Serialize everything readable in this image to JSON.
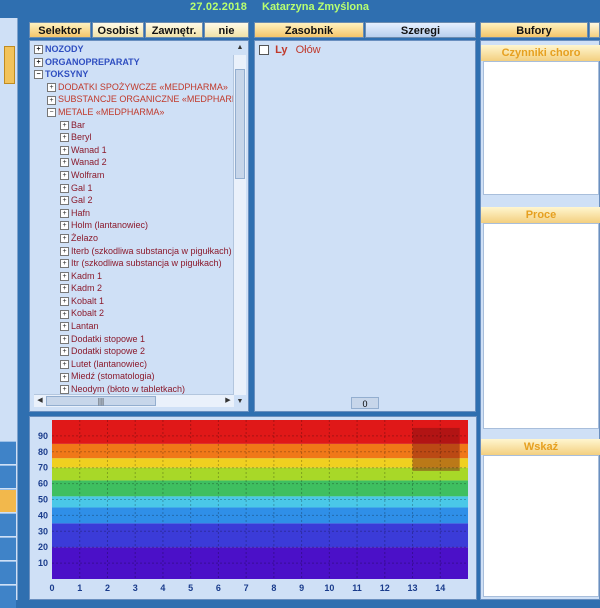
{
  "title": {
    "date": "27.02.2018",
    "user": "Katarzyna Zmyślona"
  },
  "tabs": [
    {
      "label": "Selektor",
      "active": true
    },
    {
      "label": "Osobist",
      "active": false
    },
    {
      "label": "Zawnętr.",
      "active": false
    },
    {
      "label": "nie",
      "active": false
    }
  ],
  "middle_tabs": [
    {
      "label": "Zasobnik",
      "active": true
    },
    {
      "label": "Szeregi",
      "active": false
    }
  ],
  "right_tabs": [
    {
      "label": "Bufory",
      "active": true
    }
  ],
  "tree": [
    {
      "label": "NOZODY",
      "level": 0
    },
    {
      "label": "ORGANOPREPARATY",
      "level": 0
    },
    {
      "label": "TOKSYNY",
      "level": 0
    },
    {
      "label": "DODATKI SPOŻYWCZE «MEDPHARMA»",
      "level": 1
    },
    {
      "label": "SUBSTANCJE ORGANICZNE «MEDPHARMA»",
      "level": 1
    },
    {
      "label": "METALE «MEDPHARMA»",
      "level": 1
    },
    {
      "label": "Bar",
      "level": 2
    },
    {
      "label": "Beryl",
      "level": 2
    },
    {
      "label": "Wanad 1",
      "level": 2
    },
    {
      "label": "Wanad 2",
      "level": 2
    },
    {
      "label": "Wolfram",
      "level": 2
    },
    {
      "label": "Gal 1",
      "level": 2
    },
    {
      "label": "Gal 2",
      "level": 2
    },
    {
      "label": "Hafn",
      "level": 2
    },
    {
      "label": "Holm (lantanowiec)",
      "level": 2
    },
    {
      "label": "Żelazo",
      "level": 2
    },
    {
      "label": "Iterb (szkodliwa substancja w pigułkach)",
      "level": 2
    },
    {
      "label": "Itr (szkodliwa substancja w pigułkach)",
      "level": 2
    },
    {
      "label": "Kadm 1",
      "level": 2
    },
    {
      "label": "Kadm 2",
      "level": 2
    },
    {
      "label": "Kobalt 1",
      "level": 2
    },
    {
      "label": "Kobalt 2",
      "level": 2
    },
    {
      "label": "Lantan",
      "level": 2
    },
    {
      "label": "Dodatki stopowe 1",
      "level": 2
    },
    {
      "label": "Dodatki stopowe 2",
      "level": 2
    },
    {
      "label": "Lutet (lantanowiec)",
      "level": 2
    },
    {
      "label": "Miedź (stomatologia)",
      "level": 2
    },
    {
      "label": "Neodym (błoto w tabletkach)",
      "level": 2
    }
  ],
  "zasobnik": {
    "items": [
      {
        "code": "Ly",
        "name": "Ołów",
        "checked": false
      }
    ],
    "count": "0"
  },
  "right_sections": [
    {
      "label": "Czynniki choro"
    },
    {
      "label": "Proce"
    },
    {
      "label": "Wskaź"
    }
  ],
  "icons": [
    "expand-plus-icon",
    "collapse-minus-icon",
    "scroll-up-arrow-icon",
    "scroll-down-arrow-icon",
    "scroll-left-arrow-icon",
    "scroll-right-arrow-icon"
  ],
  "colors": {
    "title_text": "#b8ff70",
    "tree_toplevel": "#2f4ec0",
    "tree_item": "#c0392b",
    "tab_active": "#f4c56a"
  },
  "chart_data": {
    "type": "heatmap",
    "x_ticks": [
      "0",
      "1",
      "2",
      "3",
      "4",
      "5",
      "6",
      "7",
      "8",
      "9",
      "10",
      "11",
      "12",
      "13",
      "14"
    ],
    "y_ticks": [
      "10",
      "20",
      "30",
      "40",
      "50",
      "60",
      "70",
      "80",
      "90"
    ],
    "xlim": [
      0,
      15
    ],
    "ylim": [
      0,
      100
    ],
    "grid": true,
    "bands": [
      {
        "from": 0,
        "to": 20,
        "color": "#4b10c8"
      },
      {
        "from": 20,
        "to": 35,
        "color": "#3b3bd8"
      },
      {
        "from": 35,
        "to": 45,
        "color": "#2f8fe8"
      },
      {
        "from": 45,
        "to": 52,
        "color": "#4ac8e8"
      },
      {
        "from": 52,
        "to": 62,
        "color": "#3fbf60"
      },
      {
        "from": 62,
        "to": 70,
        "color": "#a8d828"
      },
      {
        "from": 70,
        "to": 76,
        "color": "#f0d020"
      },
      {
        "from": 76,
        "to": 85,
        "color": "#f07818"
      },
      {
        "from": 85,
        "to": 100,
        "color": "#e01818"
      }
    ],
    "highlight": {
      "x": [
        13,
        14.7
      ],
      "y": [
        68,
        95
      ]
    }
  }
}
